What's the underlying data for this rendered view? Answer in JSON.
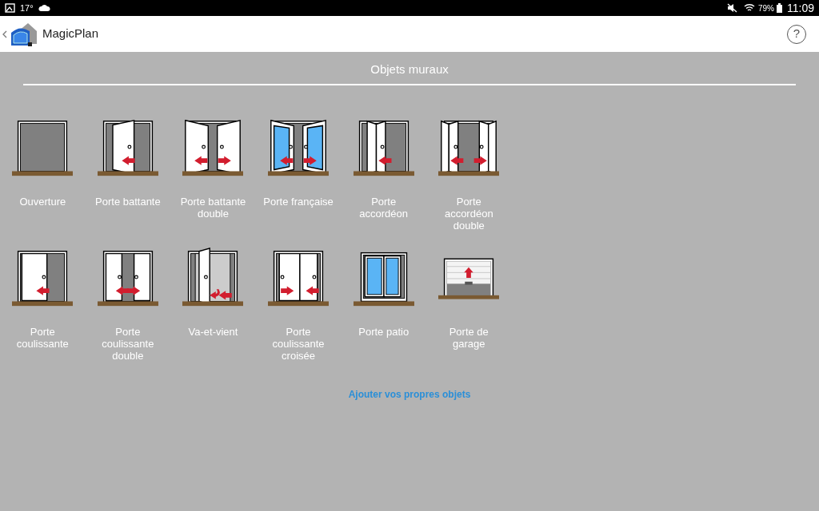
{
  "status_bar": {
    "temperature": "17°",
    "battery": "79%",
    "time": "11:09"
  },
  "app_bar": {
    "title": "MagicPlan",
    "help": "?"
  },
  "section": {
    "title": "Objets muraux"
  },
  "objects": [
    {
      "kind": "opening",
      "label": "Ouverture"
    },
    {
      "kind": "swing",
      "label": "Porte battante"
    },
    {
      "kind": "double-swing",
      "label": "Porte battante double"
    },
    {
      "kind": "french",
      "label": "Porte française"
    },
    {
      "kind": "accordion",
      "label": "Porte accordéon"
    },
    {
      "kind": "double-accordion",
      "label": "Porte accordéon double"
    },
    {
      "kind": "sliding",
      "label": "Porte coulissante"
    },
    {
      "kind": "double-sliding",
      "label": "Porte coulissante double"
    },
    {
      "kind": "swing-both",
      "label": "Va-et-vient"
    },
    {
      "kind": "bypass",
      "label": "Porte coulissante croisée"
    },
    {
      "kind": "patio",
      "label": "Porte patio"
    },
    {
      "kind": "garage",
      "label": "Porte de garage"
    }
  ],
  "link": "Ajouter vos propres objets"
}
